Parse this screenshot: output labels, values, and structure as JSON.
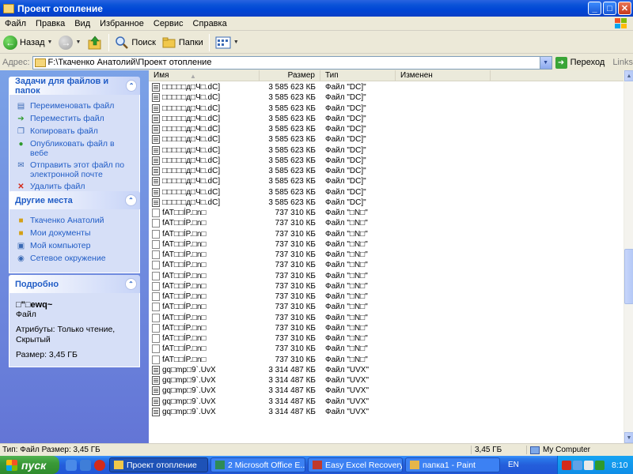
{
  "window": {
    "title": "Проект отопление",
    "minimize": "_",
    "maximize": "□",
    "close": "✕"
  },
  "menu": [
    "Файл",
    "Правка",
    "Вид",
    "Избранное",
    "Сервис",
    "Справка"
  ],
  "toolbar": {
    "back": "Назад",
    "search": "Поиск",
    "folders": "Папки"
  },
  "address": {
    "label": "Адрес:",
    "path": "F:\\Ткаченко Анатолий\\Проект отопление",
    "go": "Переход",
    "links": "Links"
  },
  "tasks": {
    "title": "Задачи для файлов и папок",
    "items": [
      {
        "label": "Переименовать файл",
        "icon": "rename-icon"
      },
      {
        "label": "Переместить файл",
        "icon": "move-icon"
      },
      {
        "label": "Копировать файл",
        "icon": "copy-icon"
      },
      {
        "label": "Опубликовать файл в вебе",
        "icon": "globe-icon"
      },
      {
        "label": "Отправить этот файл по электронной почте",
        "icon": "email-icon"
      },
      {
        "label": "Удалить файл",
        "icon": "delete-icon"
      }
    ]
  },
  "places": {
    "title": "Другие места",
    "items": [
      {
        "label": "Ткаченко Анатолий",
        "icon": "folder-icon"
      },
      {
        "label": "Мои документы",
        "icon": "my-documents-icon"
      },
      {
        "label": "Мой компьютер",
        "icon": "my-computer-icon"
      },
      {
        "label": "Сетевое окружение",
        "icon": "network-icon"
      }
    ]
  },
  "details": {
    "title": "Подробно",
    "name": "□\"□ewq~",
    "kind": "Файл",
    "attributes": "Атрибуты: Только чтение, Скрытый",
    "size": "Размер: 3,45 ГБ"
  },
  "columns": {
    "name": "Имя",
    "size": "Размер",
    "type": "Тип",
    "modified": "Изменен"
  },
  "files": [
    {
      "name": "□□□□□д□Ч□.dC]",
      "size": "3 585 623 КБ",
      "type": "Файл \"DC]\""
    },
    {
      "name": "□□□□□д□Ч□.dC]",
      "size": "3 585 623 КБ",
      "type": "Файл \"DC]\""
    },
    {
      "name": "□□□□□д□Ч□.dC]",
      "size": "3 585 623 КБ",
      "type": "Файл \"DC]\""
    },
    {
      "name": "□□□□□д□Ч□.dC]",
      "size": "3 585 623 КБ",
      "type": "Файл \"DC]\""
    },
    {
      "name": "□□□□□д□Ч□.dC]",
      "size": "3 585 623 КБ",
      "type": "Файл \"DC]\""
    },
    {
      "name": "□□□□□д□Ч□.dC]",
      "size": "3 585 623 КБ",
      "type": "Файл \"DC]\""
    },
    {
      "name": "□□□□□д□Ч□.dC]",
      "size": "3 585 623 КБ",
      "type": "Файл \"DC]\""
    },
    {
      "name": "□□□□□д□Ч□.dC]",
      "size": "3 585 623 КБ",
      "type": "Файл \"DC]\""
    },
    {
      "name": "□□□□□д□Ч□.dC]",
      "size": "3 585 623 КБ",
      "type": "Файл \"DC]\""
    },
    {
      "name": "□□□□□д□Ч□.dC]",
      "size": "3 585 623 КБ",
      "type": "Файл \"DC]\""
    },
    {
      "name": "□□□□□д□Ч□.dC]",
      "size": "3 585 623 КБ",
      "type": "Файл \"DC]\""
    },
    {
      "name": "□□□□□д□Ч□.dC]",
      "size": "3 585 623 КБ",
      "type": "Файл \"DC]\""
    },
    {
      "name": "fAT□□ÍP.□n□",
      "size": "737 310 КБ",
      "type": "Файл \"□N□\""
    },
    {
      "name": "fAT□□ÍP.□n□",
      "size": "737 310 КБ",
      "type": "Файл \"□N□\""
    },
    {
      "name": "fAT□□ÍP.□n□",
      "size": "737 310 КБ",
      "type": "Файл \"□N□\""
    },
    {
      "name": "fAT□□ÍP.□n□",
      "size": "737 310 КБ",
      "type": "Файл \"□N□\""
    },
    {
      "name": "fAT□□ÍP.□n□",
      "size": "737 310 КБ",
      "type": "Файл \"□N□\""
    },
    {
      "name": "fAT□□ÍP.□n□",
      "size": "737 310 КБ",
      "type": "Файл \"□N□\""
    },
    {
      "name": "fAT□□ÍP.□n□",
      "size": "737 310 КБ",
      "type": "Файл \"□N□\""
    },
    {
      "name": "fAT□□ÍP.□n□",
      "size": "737 310 КБ",
      "type": "Файл \"□N□\""
    },
    {
      "name": "fAT□□ÍP.□n□",
      "size": "737 310 КБ",
      "type": "Файл \"□N□\""
    },
    {
      "name": "fAT□□ÍP.□n□",
      "size": "737 310 КБ",
      "type": "Файл \"□N□\""
    },
    {
      "name": "fAT□□ÍP.□n□",
      "size": "737 310 КБ",
      "type": "Файл \"□N□\""
    },
    {
      "name": "fAT□□ÍP.□n□",
      "size": "737 310 КБ",
      "type": "Файл \"□N□\""
    },
    {
      "name": "fAT□□ÍP.□n□",
      "size": "737 310 КБ",
      "type": "Файл \"□N□\""
    },
    {
      "name": "fAT□□ÍP.□n□",
      "size": "737 310 КБ",
      "type": "Файл \"□N□\""
    },
    {
      "name": "fAT□□ÍP.□n□",
      "size": "737 310 КБ",
      "type": "Файл \"□N□\""
    },
    {
      "name": "gq□mp□9`.UvX",
      "size": "3 314 487 КБ",
      "type": "Файл \"UVX\""
    },
    {
      "name": "gq□mp□9`.UvX",
      "size": "3 314 487 КБ",
      "type": "Файл \"UVX\""
    },
    {
      "name": "gq□mp□9`.UvX",
      "size": "3 314 487 КБ",
      "type": "Файл \"UVX\""
    },
    {
      "name": "gq□mp□9`.UvX",
      "size": "3 314 487 КБ",
      "type": "Файл \"UVX\""
    },
    {
      "name": "gq□mp□9`.UvX",
      "size": "3 314 487 КБ",
      "type": "Файл \"UVX\""
    }
  ],
  "status": {
    "left": "Тип: Файл Размер: 3,45 ГБ",
    "size": "3,45 ГБ",
    "zone": "My Computer"
  },
  "taskbar": {
    "start": "пуск",
    "tasks": [
      "Проект отопление",
      "2 Microsoft Office E...",
      "Easy Excel Recovery ...",
      "папка1 - Paint"
    ],
    "lang": "EN",
    "time": "8:10"
  }
}
